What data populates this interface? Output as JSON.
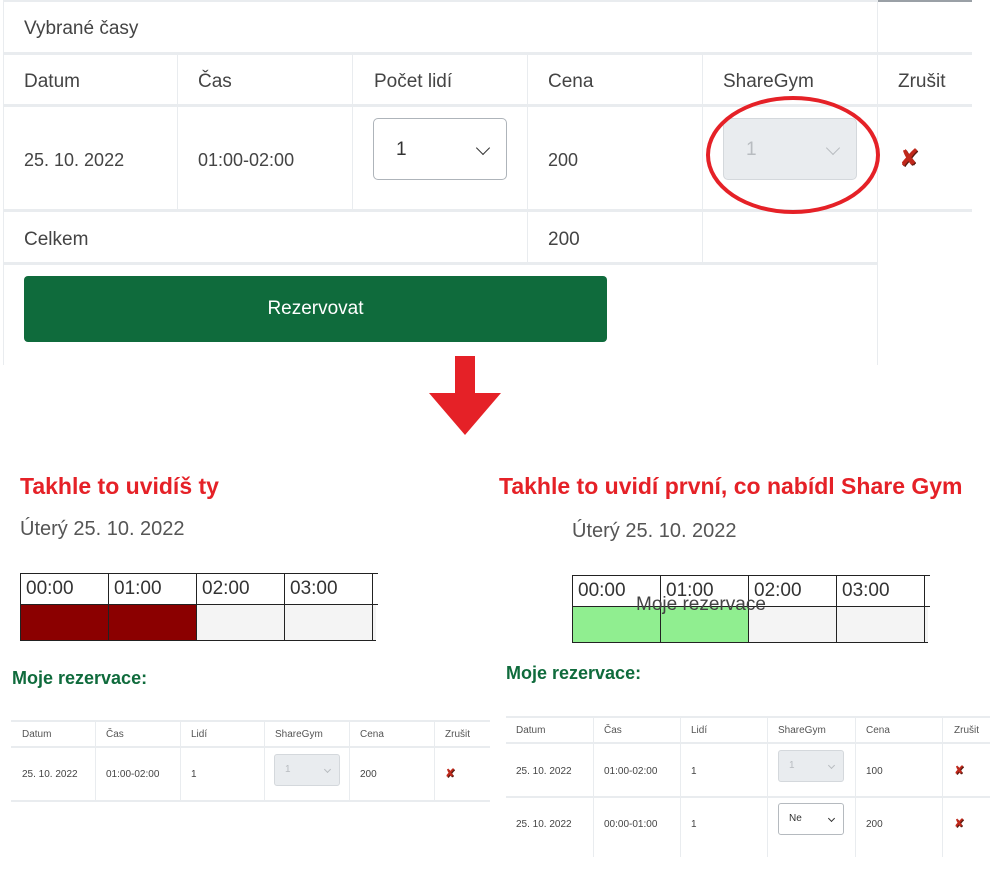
{
  "top": {
    "section_title": "Vybrané časy",
    "columns": [
      "Datum",
      "Čas",
      "Počet lidí",
      "Cena",
      "ShareGym",
      "Zrušit"
    ],
    "row": {
      "date": "25. 10. 2022",
      "time": "01:00-02:00",
      "people": "1",
      "price": "200",
      "sharegym": "1"
    },
    "total_label": "Celkem",
    "total_value": "200",
    "reserve_button": "Rezervovat"
  },
  "left": {
    "heading": "Takhle to uvidíš ty",
    "day": "Úterý 25. 10. 2022",
    "hours": [
      "00:00",
      "01:00",
      "02:00",
      "03:00"
    ],
    "slot_states": [
      "reserved",
      "reserved",
      "free",
      "free"
    ],
    "reservations_title": "Moje rezervace:",
    "columns": [
      "Datum",
      "Čas",
      "Lidí",
      "ShareGym",
      "Cena",
      "Zrušit"
    ],
    "rows": [
      {
        "date": "25. 10. 2022",
        "time": "01:00-02:00",
        "people": "1",
        "sharegym": "1",
        "price": "200"
      }
    ]
  },
  "right": {
    "heading": "Takhle to uvidí první, co nabídl Share Gym",
    "day": "Úterý 25. 10. 2022",
    "hours": [
      "00:00",
      "01:00",
      "02:00",
      "03:00"
    ],
    "slot_states": [
      "mine",
      "mine",
      "free",
      "free"
    ],
    "overlay_text": "Moje rezervace",
    "reservations_title": "Moje rezervace:",
    "columns": [
      "Datum",
      "Čas",
      "Lidí",
      "ShareGym",
      "Cena",
      "Zrušit"
    ],
    "rows": [
      {
        "date": "25. 10. 2022",
        "time": "01:00-02:00",
        "people": "1",
        "sharegym": "1",
        "price": "100"
      },
      {
        "date": "25. 10. 2022",
        "time": "00:00-01:00",
        "people": "1",
        "sharegym": "Ne",
        "price": "200"
      }
    ]
  },
  "colors": {
    "annotation_red": "#e52127",
    "reserve_green": "#0f6b3c",
    "slot_reserved": "#8b0000",
    "slot_mine": "#90ee90",
    "slot_free": "#f4f4f4"
  },
  "icons": {
    "cancel": "cancel-x-icon",
    "dropdown": "chevron-down-icon",
    "arrow": "arrow-down-icon"
  }
}
